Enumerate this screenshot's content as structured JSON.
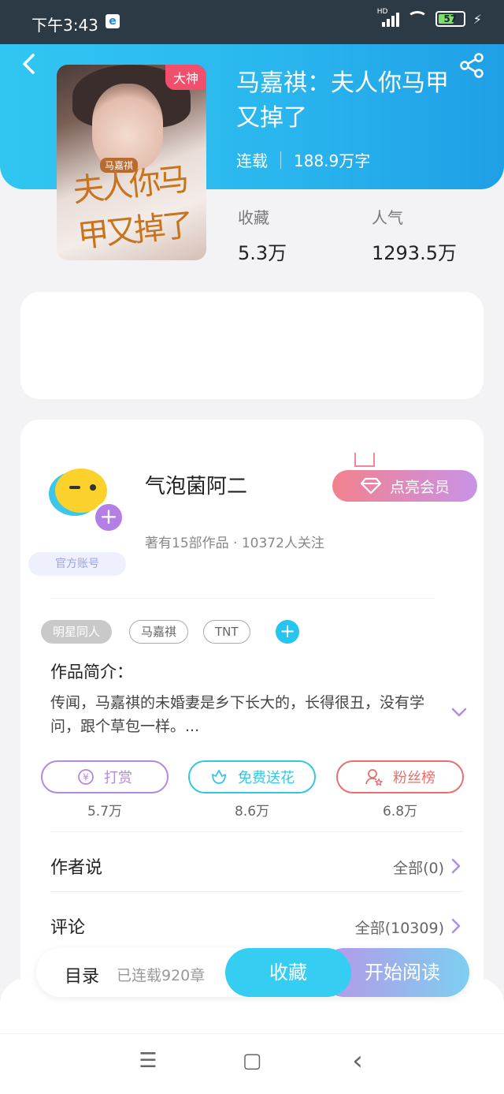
{
  "status_bar": {
    "time": "下午3:43",
    "network": "HD",
    "battery": "57"
  },
  "book": {
    "badge": "大神",
    "cover_small_text": "马嘉祺",
    "cover_title": "夫人你马甲又掉了",
    "title": "马嘉祺：夫人你马甲又掉了",
    "status": "连载",
    "word_count": "188.9万字",
    "stats": [
      {
        "label": "收藏",
        "value": "5.3万"
      },
      {
        "label": "人气",
        "value": "1293.5万"
      }
    ]
  },
  "author": {
    "name": "气泡菌阿二",
    "info": "著有15部作品 · 10372人关注",
    "official_badge": "官方账号",
    "vip_button": "点亮会员"
  },
  "tags": [
    "明星同人",
    "马嘉祺",
    "TNT"
  ],
  "intro": {
    "title": "作品简介：",
    "text": "传闻，马嘉祺的未婚妻是乡下长大的，长得很丑，没有学问，跟个草包一样。..."
  },
  "actions": [
    {
      "label": "打赏",
      "count": "5.7万",
      "color": "#b38ae0",
      "icon": "yen-coin-icon"
    },
    {
      "label": "免费送花",
      "count": "8.6万",
      "color": "#36c7e0",
      "icon": "flower-icon"
    },
    {
      "label": "粉丝榜",
      "count": "6.8万",
      "color": "#e76f6f",
      "icon": "fan-user-icon"
    }
  ],
  "rows": [
    {
      "title": "作者说",
      "link": "全部(0)"
    },
    {
      "title": "评论",
      "link": "全部(10309)"
    }
  ],
  "bottom_bar": {
    "toc_label": "目录",
    "toc_count": "已连载920章",
    "favorite_button": "收藏",
    "read_button": "开始阅读"
  },
  "nav": {
    "menu": "☰",
    "home": "▢",
    "back": "‹"
  },
  "colors": {
    "header_blue": "#2ab6ee",
    "accent_cyan": "#35cdf2",
    "badge_red": "#f0506c",
    "vip_gradient_start": "#f2818d",
    "vip_gradient_end": "#c993e8"
  }
}
